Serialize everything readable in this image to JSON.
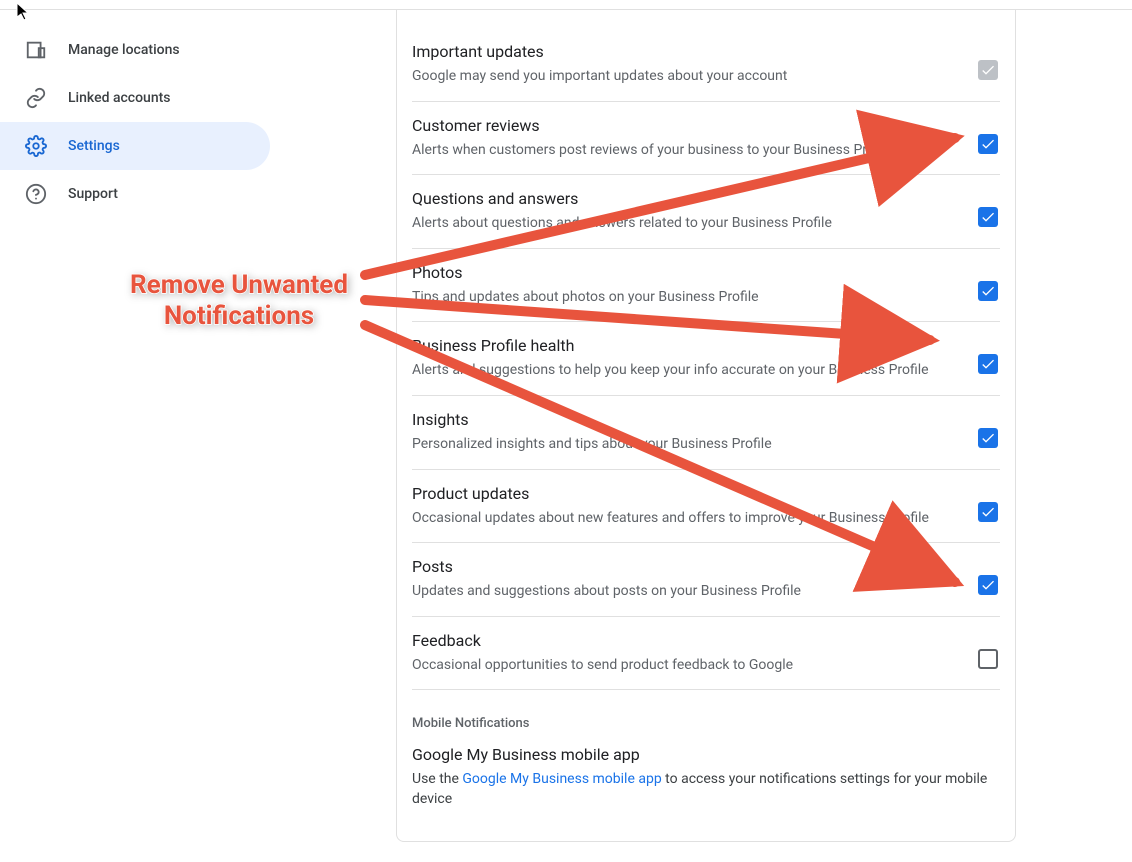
{
  "sidebar": {
    "items": [
      {
        "label": "Manage locations"
      },
      {
        "label": "Linked accounts"
      },
      {
        "label": "Settings"
      },
      {
        "label": "Support"
      }
    ]
  },
  "settings": {
    "rows": [
      {
        "title": "Important updates",
        "desc": "Google may send you important updates about your account"
      },
      {
        "title": "Customer reviews",
        "desc": "Alerts when customers post reviews of your business to your Business Profile"
      },
      {
        "title": "Questions and answers",
        "desc": "Alerts about questions and answers related to your Business Profile"
      },
      {
        "title": "Photos",
        "desc": "Tips and updates about photos on your Business Profile"
      },
      {
        "title": "Business Profile health",
        "desc": "Alerts and suggestions to help you keep your info accurate on your Business Profile"
      },
      {
        "title": "Insights",
        "desc": "Personalized insights and tips about your Business Profile"
      },
      {
        "title": "Product updates",
        "desc": "Occasional updates about new features and offers to improve your Business Profile"
      },
      {
        "title": "Posts",
        "desc": "Updates and suggestions about posts on your Business Profile"
      },
      {
        "title": "Feedback",
        "desc": "Occasional opportunities to send product feedback to Google"
      }
    ],
    "mobile_section": "Mobile Notifications",
    "mobile_title": "Google My Business mobile app",
    "mobile_desc_pre": "Use the ",
    "mobile_link": "Google My Business mobile app",
    "mobile_desc_post": " to access your notifications settings for your mobile device"
  },
  "annotation": {
    "line1": "Remove Unwanted",
    "line2": "Notifications"
  }
}
